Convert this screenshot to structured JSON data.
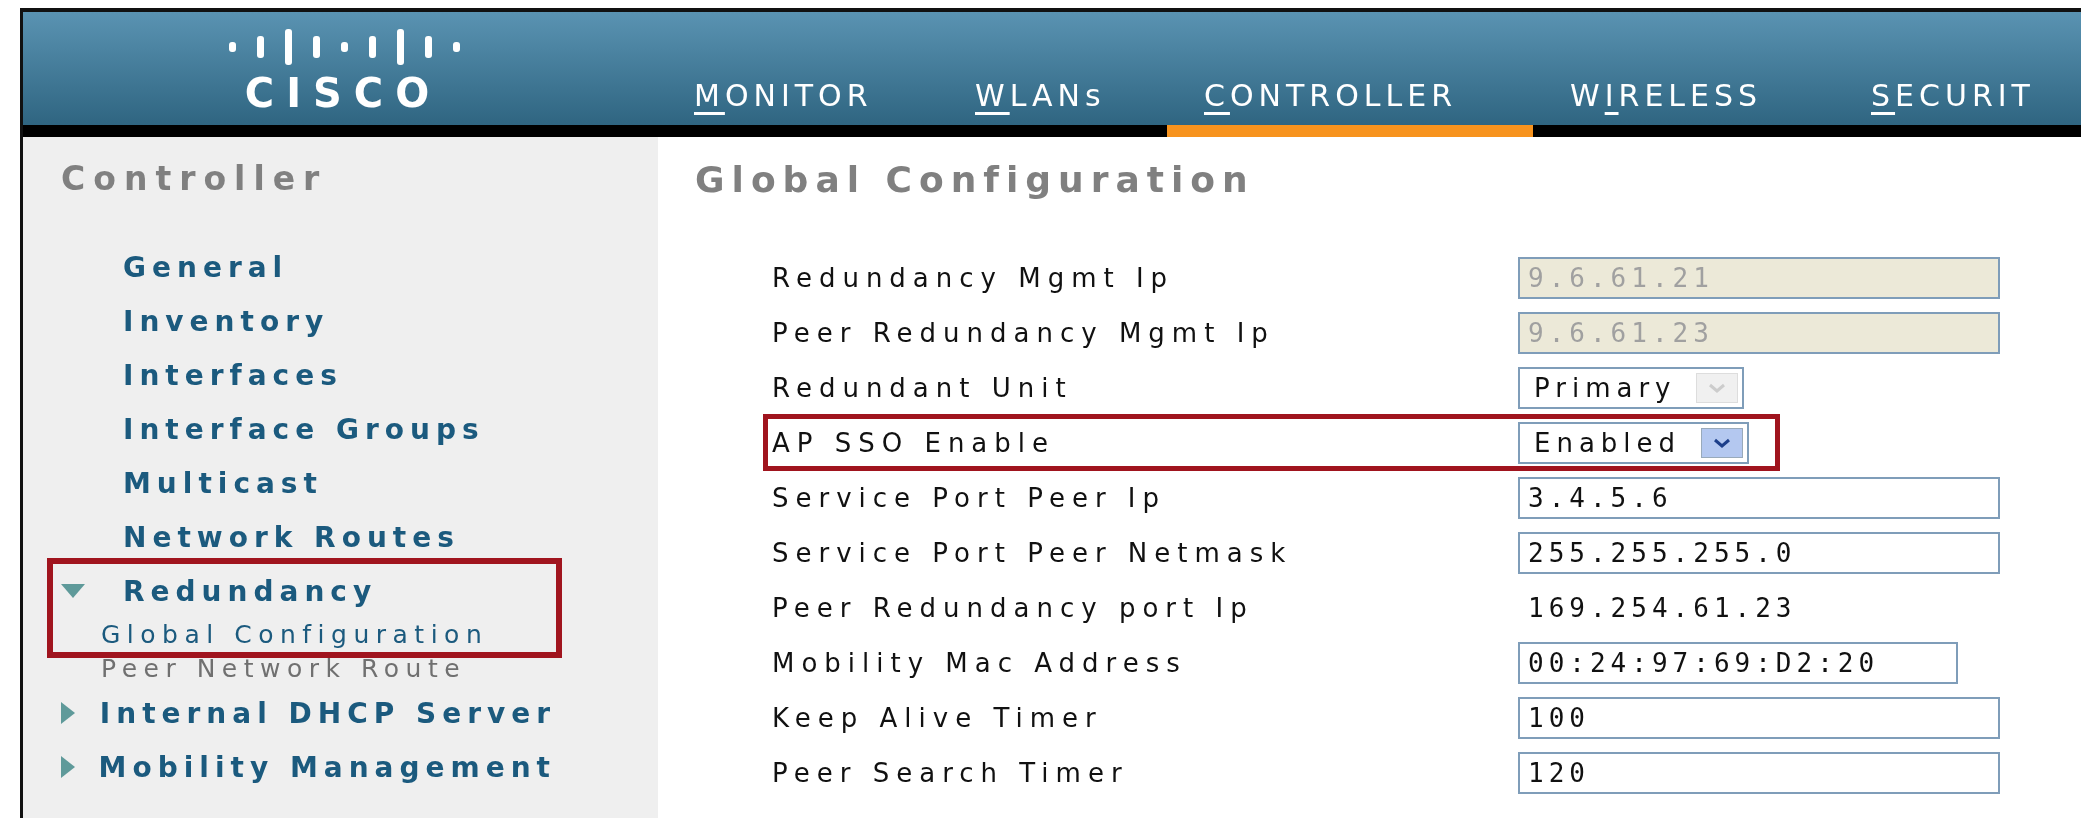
{
  "header": {
    "logo_text": "CISCO",
    "nav": [
      {
        "key": "M",
        "after": "ONITOR",
        "selected": false
      },
      {
        "key": "W",
        "after": "LANs",
        "selected": false
      },
      {
        "key": "C",
        "after": "ONTROLLER",
        "selected": true
      },
      {
        "before": "W",
        "key": "I",
        "after": "RELESS",
        "selected": false
      },
      {
        "key": "S",
        "after": "ECURIT",
        "selected": false
      }
    ]
  },
  "sidebar": {
    "title": "Controller",
    "items": [
      {
        "kind": "link",
        "label": "General"
      },
      {
        "kind": "link",
        "label": "Inventory"
      },
      {
        "kind": "link",
        "label": "Interfaces"
      },
      {
        "kind": "link",
        "label": "Interface Groups"
      },
      {
        "kind": "link",
        "label": "Multicast"
      },
      {
        "kind": "link",
        "label": "Network Routes"
      },
      {
        "kind": "folder",
        "label": "Redundancy",
        "expanded": true,
        "highlighted": true,
        "children": [
          {
            "label": "Global Configuration",
            "selected": true
          },
          {
            "label": "Peer Network Route",
            "selected": false
          }
        ]
      },
      {
        "kind": "folder",
        "label": "Internal DHCP Server",
        "expanded": false,
        "highlighted": false
      },
      {
        "kind": "folder",
        "label": "Mobility Management",
        "expanded": false,
        "highlighted": false
      }
    ]
  },
  "page": {
    "title": "Global Configuration",
    "fields": [
      {
        "label": "Redundancy Mgmt Ip",
        "kind": "input",
        "value": "9.6.61.21",
        "disabled": true,
        "highlighted": false
      },
      {
        "label": "Peer Redundancy Mgmt Ip",
        "kind": "input",
        "value": "9.6.61.23",
        "disabled": true,
        "highlighted": false
      },
      {
        "label": "Redundant Unit",
        "kind": "select",
        "value": "Primary",
        "disabled": true,
        "highlighted": false
      },
      {
        "label": "AP SSO Enable",
        "kind": "select",
        "value": "Enabled",
        "disabled": false,
        "highlighted": true
      },
      {
        "label": "Service Port Peer Ip",
        "kind": "input",
        "value": "3.4.5.6",
        "disabled": false,
        "highlighted": false
      },
      {
        "label": "Service Port Peer Netmask",
        "kind": "input",
        "value": "255.255.255.0",
        "disabled": false,
        "highlighted": false
      },
      {
        "label": "Peer Redundancy port Ip",
        "kind": "text",
        "value": "169.254.61.23",
        "highlighted": false
      },
      {
        "label": "Mobility Mac Address",
        "kind": "input",
        "value": "00:24:97:69:D2:20",
        "disabled": false,
        "short": true,
        "highlighted": false
      },
      {
        "label": "Keep Alive Timer",
        "kind": "input",
        "value": "100",
        "disabled": false,
        "highlighted": false
      },
      {
        "label": "Peer Search Timer",
        "kind": "input",
        "value": "120",
        "disabled": false,
        "highlighted": false
      }
    ]
  }
}
